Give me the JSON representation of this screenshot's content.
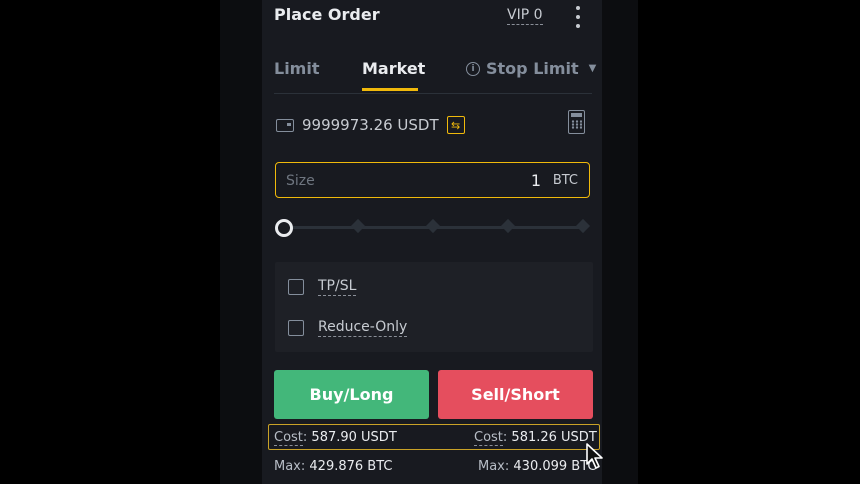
{
  "header": {
    "title": "Place Order",
    "vip": "VIP 0"
  },
  "tabs": [
    {
      "label": "Limit",
      "active": false
    },
    {
      "label": "Market",
      "active": true
    },
    {
      "label": "Stop Limit",
      "active": false
    }
  ],
  "balance": {
    "amount": "9999973.26 USDT"
  },
  "size_input": {
    "label": "Size",
    "value": "1",
    "unit": "BTC"
  },
  "slider": {
    "percent": 0,
    "steps": [
      0,
      25,
      50,
      75,
      100
    ]
  },
  "options": [
    {
      "label": "TP/SL",
      "checked": false
    },
    {
      "label": "Reduce-Only",
      "checked": false
    }
  ],
  "actions": {
    "buy_label": "Buy/Long",
    "sell_label": "Sell/Short"
  },
  "buy_info": {
    "cost_label": "Cost",
    "cost_value": "587.90 USDT",
    "max_label": "Max",
    "max_value": "429.876 BTC"
  },
  "sell_info": {
    "cost_label": "Cost",
    "cost_value": "581.26 USDT",
    "max_label": "Max",
    "max_value": "430.099 BTC"
  },
  "colors": {
    "accent": "#f0b90b",
    "buy": "#43b77a",
    "sell": "#e54e5e",
    "panel": "#181a20"
  },
  "icons": [
    "wallet-icon",
    "transfer-icon",
    "calculator-icon",
    "info-icon",
    "caret-down-icon",
    "more-vertical-icon",
    "cursor-icon"
  ]
}
